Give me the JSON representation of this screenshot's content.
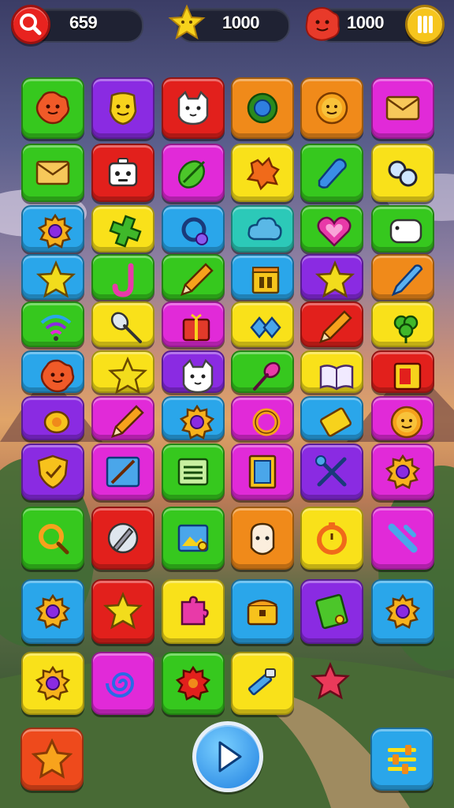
{
  "hud": {
    "search_count": "659",
    "stars": "1000",
    "gems": "1000"
  },
  "colors": {
    "green": "#36c81e",
    "purple": "#8a2be2",
    "red": "#e2201c",
    "orange": "#f08a1a",
    "yellow": "#f9e11a",
    "magenta": "#e12ad8",
    "blue": "#2aa6ea",
    "teal": "#2cc9b8"
  },
  "board": {
    "rows": [
      [
        {
          "color": "green",
          "icon": "flower-blob-icon"
        },
        {
          "color": "purple",
          "icon": "smiley-face-icon"
        },
        {
          "color": "red",
          "icon": "cat-face-icon"
        },
        {
          "color": "orange",
          "icon": "blue-orb-gear-icon"
        },
        {
          "color": "orange",
          "icon": "sun-face-icon"
        },
        {
          "color": "magenta",
          "icon": "envelope-icon"
        }
      ],
      [
        {
          "color": "green",
          "icon": "envelope-icon"
        },
        {
          "color": "red",
          "icon": "robot-face-icon"
        },
        {
          "color": "magenta",
          "icon": "leaf-brush-icon"
        },
        {
          "color": "yellow",
          "icon": "orange-splat-icon"
        },
        {
          "color": "green",
          "icon": "blue-wrench-icon"
        },
        {
          "color": "yellow",
          "icon": "rings-icon"
        }
      ],
      [
        {
          "color": "blue",
          "icon": "gear-icon"
        },
        {
          "color": "yellow",
          "icon": "cross-leaf-icon"
        },
        {
          "color": "blue",
          "icon": "magnifier-icon"
        },
        {
          "color": "teal",
          "icon": "cloud-icon"
        },
        {
          "color": "green",
          "icon": "heart-icon"
        },
        {
          "color": "green",
          "icon": "sheep-icon"
        }
      ],
      [
        {
          "color": "blue",
          "icon": "star-icon"
        },
        {
          "color": "green",
          "icon": "hook-icon"
        },
        {
          "color": "green",
          "icon": "pencil-icon"
        },
        {
          "color": "blue",
          "icon": "house-icon"
        },
        {
          "color": "purple",
          "icon": "star-icon"
        },
        {
          "color": "orange",
          "icon": "pen-icon"
        }
      ],
      [
        {
          "color": "green",
          "icon": "wifi-icon"
        },
        {
          "color": "yellow",
          "icon": "spoon-icon"
        },
        {
          "color": "magenta",
          "icon": "gift-icon"
        },
        {
          "color": "yellow",
          "icon": "blue-gems-icon"
        },
        {
          "color": "red",
          "icon": "pencil-icon"
        },
        {
          "color": "yellow",
          "icon": "clover-icon"
        }
      ],
      [
        {
          "color": "blue",
          "icon": "flower-blob-icon"
        },
        {
          "color": "yellow",
          "icon": "star-icon"
        },
        {
          "color": "purple",
          "icon": "cat-face-icon"
        },
        {
          "color": "green",
          "icon": "brush-icon"
        },
        {
          "color": "yellow",
          "icon": "book-icon"
        },
        {
          "color": "red",
          "icon": "card-icon"
        }
      ],
      [
        {
          "color": "purple",
          "icon": "lemon-icon"
        },
        {
          "color": "magenta",
          "icon": "pencil-icon"
        },
        {
          "color": "blue",
          "icon": "gear-icon"
        },
        {
          "color": "magenta",
          "icon": "ring-icon"
        },
        {
          "color": "blue",
          "icon": "tag-icon"
        },
        {
          "color": "magenta",
          "icon": "sun-face-icon"
        }
      ],
      [
        {
          "color": "purple",
          "icon": "shield-check-icon"
        },
        {
          "color": "magenta",
          "icon": "paintbrush-icon"
        },
        {
          "color": "green",
          "icon": "list-icon"
        },
        {
          "color": "magenta",
          "icon": "door-icon"
        },
        {
          "color": "purple",
          "icon": "tools-icon"
        },
        {
          "color": "magenta",
          "icon": "gear-icon"
        }
      ],
      [
        {
          "color": "green",
          "icon": "search-icon"
        },
        {
          "color": "red",
          "icon": "pen-nib-icon"
        },
        {
          "color": "green",
          "icon": "picture-icon"
        },
        {
          "color": "orange",
          "icon": "ghost-face-icon"
        },
        {
          "color": "yellow",
          "icon": "timer-icon"
        },
        {
          "color": "magenta",
          "icon": "slash-x-icon"
        }
      ],
      [
        {
          "color": "blue",
          "icon": "gear-icon"
        },
        {
          "color": "red",
          "icon": "star-icon"
        },
        {
          "color": "yellow",
          "icon": "puzzle-icon"
        },
        {
          "color": "blue",
          "icon": "chest-icon"
        },
        {
          "color": "purple",
          "icon": "note-icon"
        },
        {
          "color": "blue",
          "icon": "gear-icon"
        }
      ],
      [
        {
          "color": "yellow",
          "icon": "gear-icon"
        },
        {
          "color": "magenta",
          "icon": "swirl-icon"
        },
        {
          "color": "green",
          "icon": "red-gear-icon"
        },
        {
          "color": "yellow",
          "icon": "hammer-icon"
        },
        {
          "color": "none",
          "icon": "pink-star-icon"
        }
      ]
    ]
  }
}
